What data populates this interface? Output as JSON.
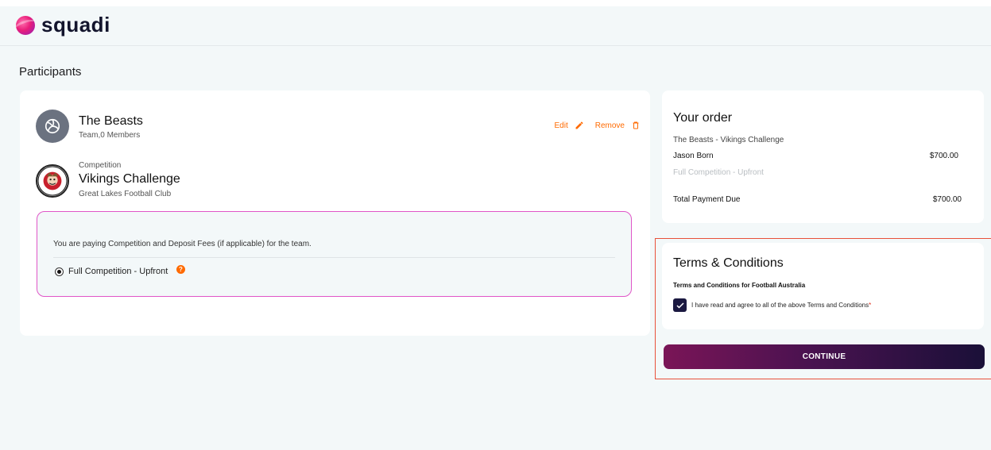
{
  "app": {
    "logo_text": "squadi"
  },
  "page": {
    "section_title": "Participants"
  },
  "participant": {
    "team_name": "The Beasts",
    "team_meta": "Team,0 Members",
    "edit_label": "Edit",
    "remove_label": "Remove"
  },
  "competition": {
    "label": "Competition",
    "name": "Vikings Challenge",
    "club": "Great Lakes Football Club"
  },
  "fees": {
    "info": "You are paying Competition and Deposit Fees (if applicable) for the team.",
    "option_label": "Full Competition - Upfront",
    "help_glyph": "?"
  },
  "order": {
    "title": "Your order",
    "description": "The Beasts - Vikings Challenge",
    "person": "Jason Born",
    "price": "$700.00",
    "plan": "Full Competition - Upfront",
    "total_label": "Total Payment Due",
    "total": "$700.00"
  },
  "terms": {
    "title": "Terms & Conditions",
    "subtitle": "Terms and Conditions for Football Australia",
    "agree_label": "I have read and agree to all of the above Terms and Conditions",
    "required_mark": "*"
  },
  "actions": {
    "continue_label": "CONTINUE"
  },
  "colors": {
    "accent_orange": "#ff6a00",
    "brand_dark": "#1a1840",
    "fee_border": "#e056c8",
    "highlight": "#e8503a"
  }
}
